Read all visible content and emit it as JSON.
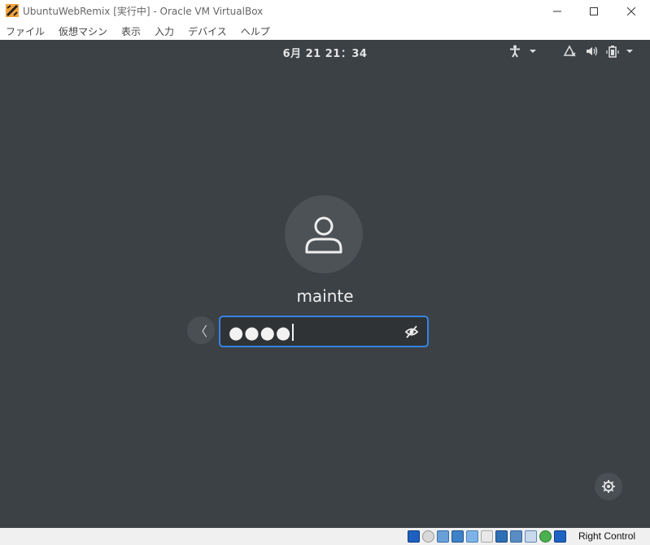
{
  "window": {
    "title": "UbuntuWebRemix [実行中] - Oracle VM VirtualBox",
    "minimize_icon": "minimize-icon",
    "maximize_icon": "maximize-icon",
    "close_icon": "close-icon"
  },
  "menubar": {
    "items": [
      {
        "label": "ファイル"
      },
      {
        "label": "仮想マシン"
      },
      {
        "label": "表示"
      },
      {
        "label": "入力"
      },
      {
        "label": "デバイス"
      },
      {
        "label": "ヘルプ"
      }
    ]
  },
  "vm": {
    "clock": "6月 21  21：34",
    "tray": {
      "accessibility_icon": "accessibility-icon",
      "network_icon": "network-icon",
      "volume_icon": "volume-icon",
      "battery_icon": "battery-icon",
      "dropdown_icon": "chevron-down-icon"
    },
    "user": {
      "avatar_icon": "user-avatar-icon",
      "name": "mainte"
    },
    "password": {
      "masked_value": "●●●●",
      "reveal_icon": "eye-hidden-icon"
    },
    "back_icon": "chevron-left-icon",
    "back_glyph": "〈",
    "settings_icon": "gear-icon",
    "colors": {
      "background": "#3c4146",
      "focus_ring": "#3584e4"
    }
  },
  "statusbar": {
    "icons": [
      "hard-disk-icon",
      "optical-drive-icon",
      "audio-icon",
      "network-adapter-icon",
      "usb-icon",
      "shared-folder-icon",
      "display-icon",
      "recording-icon",
      "virtualization-icon",
      "cpu-icon",
      "mouse-integration-icon"
    ],
    "host_key": "Right Control"
  }
}
